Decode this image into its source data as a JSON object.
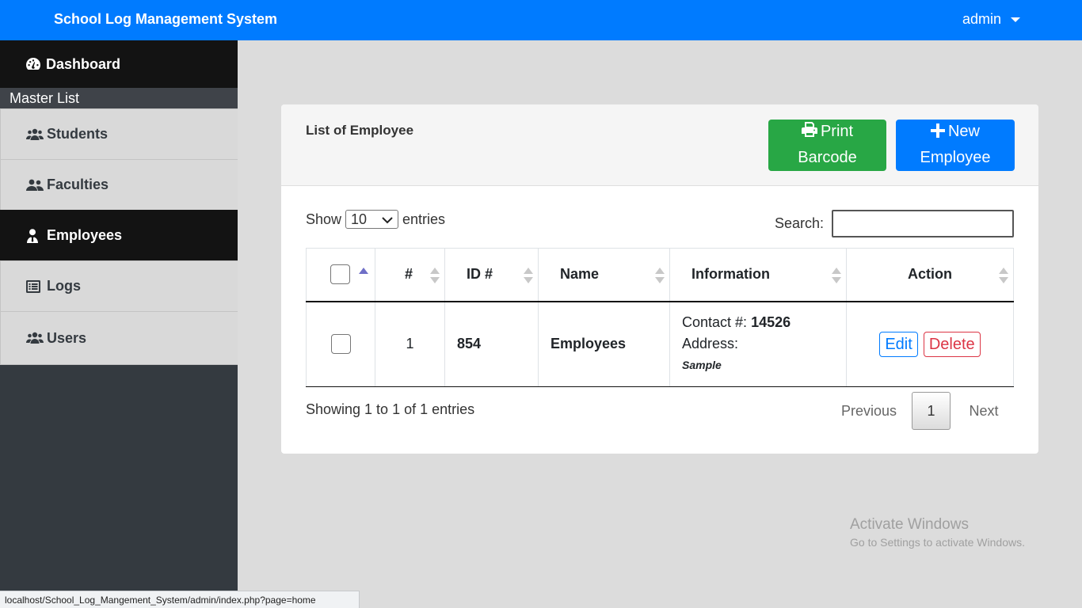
{
  "app": {
    "title": "School Log Management System",
    "user": "admin"
  },
  "sidebar": {
    "dashboard": "Dashboard",
    "section_header": "Master List",
    "items": [
      {
        "label": "Students",
        "icon": "users-icon"
      },
      {
        "label": "Faculties",
        "icon": "user-friends-icon"
      },
      {
        "label": "Employees",
        "icon": "user-tie-icon",
        "active": true
      },
      {
        "label": "Logs",
        "icon": "list-alt-icon"
      },
      {
        "label": "Users",
        "icon": "users-icon"
      }
    ]
  },
  "card": {
    "title": "List of Employee",
    "print_button": {
      "line1": "Print",
      "line2": "Barcode"
    },
    "new_button": {
      "line1": "New",
      "line2": "Employee"
    }
  },
  "datatable": {
    "show_label": "Show",
    "page_size": "10",
    "entries_label": "entries",
    "search_label": "Search:",
    "search_value": "",
    "columns": [
      "#",
      "ID #",
      "Name",
      "Information",
      "Action"
    ],
    "rows": [
      {
        "num": "1",
        "id": "854",
        "name": "Employees",
        "contact_label": "Contact #:",
        "contact": "14526",
        "address_label": "Address:",
        "address": "Sample",
        "edit": "Edit",
        "delete": "Delete"
      }
    ],
    "info": "Showing 1 to 1 of 1 entries",
    "pagination": {
      "previous": "Previous",
      "current": "1",
      "next": "Next"
    }
  },
  "watermark": {
    "line1": "Activate Windows",
    "line2": "Go to Settings to activate Windows."
  },
  "statusbar": {
    "url": "localhost/School_Log_Mangement_System/admin/index.php?page=home"
  },
  "colors": {
    "primary": "#007bff",
    "success": "#28a745",
    "danger": "#dc3545",
    "sidebar_dark": "#343a40"
  }
}
